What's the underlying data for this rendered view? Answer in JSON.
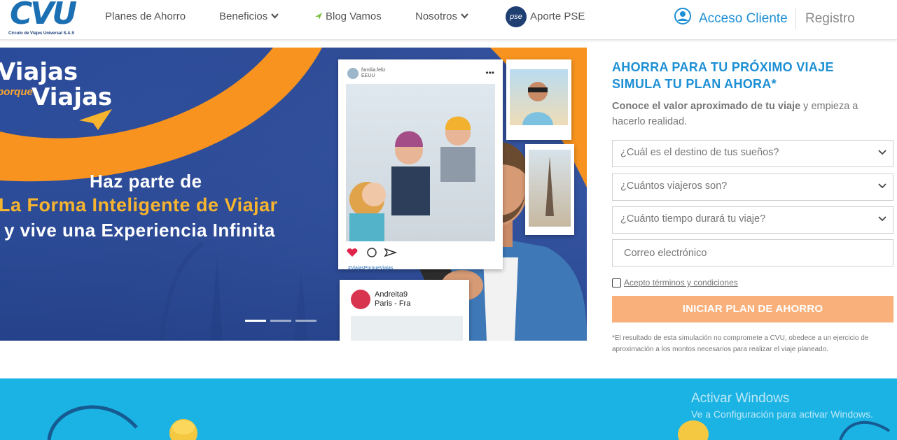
{
  "header": {
    "logo_text": "CVU",
    "logo_subtitle": "Circulo de Viajes Universal S.A.S",
    "nav": {
      "planes": "Planes de Ahorro",
      "beneficios": "Beneficios",
      "blog": "Blog Vamos",
      "nosotros": "Nosotros",
      "aporte": "Aporte PSE"
    },
    "pse_badge": "pse",
    "acceso": "Acceso Cliente",
    "registro": "Registro"
  },
  "banner": {
    "brand_line1": "Viajas",
    "brand_porque": "porque",
    "brand_line2": "Viajas",
    "headline1": "Haz parte de",
    "headline2": "La Forma Inteligente de Viajar",
    "headline3": "y vive una Experiencia Infinita",
    "post1": {
      "user": "familia.feliz",
      "location": "EEUU",
      "hashtag": "#ViajasPorqueViajas"
    },
    "post3": {
      "user": "Andreita9",
      "location": "Paris - Fra"
    },
    "slides": 3,
    "active_slide": 1
  },
  "form": {
    "title_line1": "AHORRA PARA TU PRÓXIMO VIAJE",
    "title_line2": "SIMULA TU PLAN AHORA*",
    "intro_bold": "Conoce el valor aproximado de tu viaje",
    "intro_rest": " y empieza a hacerlo realidad.",
    "destino": "¿Cuál es el destino de tus sueños?",
    "viajeros": "¿Cuántos viajeros son?",
    "tiempo": "¿Cuánto tiempo durará tu viaje?",
    "email_placeholder": "Correo electrónico",
    "terms": "Acepto términos y condiciones",
    "cta": "INICIAR PLAN DE AHORRO",
    "disclaimer": "*El resultado de esta simulación no compromete a CVU, obedece a un ejercicio de aproximación a los montos necesarios para realizar el viaje planeado."
  },
  "watermark": {
    "line1": "Activar Windows",
    "line2": "Ve a Configuración para activar Windows."
  },
  "colors": {
    "accent_blue": "#1d8fd4",
    "banner_blue": "#2f4c97",
    "orange": "#f7a531",
    "cta": "#f9b07a",
    "strip": "#1bb3e4"
  }
}
